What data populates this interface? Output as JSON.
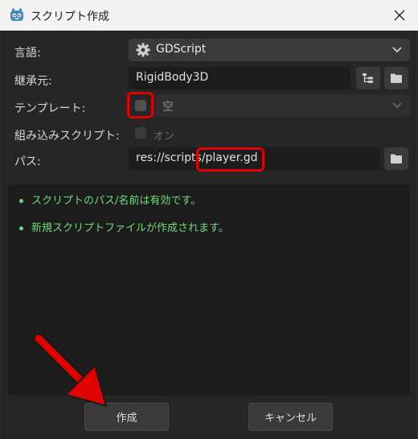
{
  "window": {
    "title": "スクリプト作成"
  },
  "form": {
    "language_label": "言語:",
    "language_value": "GDScript",
    "inherits_label": "継承元:",
    "inherits_value": "RigidBody3D",
    "template_label": "テンプレート:",
    "template_value": "空",
    "builtin_label": "組み込みスクリプト:",
    "builtin_value": "オン",
    "path_label": "パス:",
    "path_value": "res://scripts/player.gd"
  },
  "messages": [
    "スクリプトのパス/名前は有効です。",
    "新規スクリプトファイルが作成されます。"
  ],
  "buttons": {
    "create": "作成",
    "cancel": "キャンセル"
  },
  "icons": {
    "app": "godot-icon",
    "language": "gear-icon",
    "inherits_tree": "tree-icon",
    "inherits_browse": "folder-icon",
    "path_browse": "folder-icon",
    "close": "close-icon"
  },
  "colors": {
    "highlight": "#e00000",
    "success_text": "#6edc7c",
    "arrow": "#e00000"
  }
}
